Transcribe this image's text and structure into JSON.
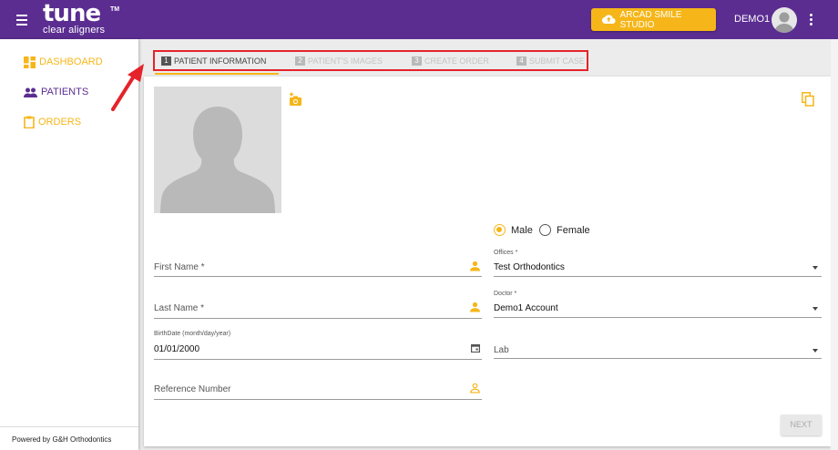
{
  "brand": {
    "logo_main": "tune",
    "logo_tm": "TM",
    "logo_sub": "clear aligners",
    "primary_color": "#5b2d91",
    "accent_color": "#f6b619"
  },
  "header": {
    "menu_icon": "hamburger-icon",
    "arcad_button_label": "ARCAD SMILE STUDIO",
    "arcad_icon": "cloud-upload-icon",
    "user_name": "DEMO1",
    "more_icon": "kebab-menu-icon"
  },
  "sidebar": {
    "items": [
      {
        "label": "DASHBOARD",
        "icon": "dashboard-icon"
      },
      {
        "label": "PATIENTS",
        "icon": "people-icon"
      },
      {
        "label": "ORDERS",
        "icon": "clipboard-icon"
      }
    ],
    "footer": "Powered by G&H Orthodontics"
  },
  "tabs": [
    {
      "num": "1",
      "label": "PATIENT INFORMATION",
      "active": true
    },
    {
      "num": "2",
      "label": "PATIENT'S IMAGES",
      "active": false
    },
    {
      "num": "3",
      "label": "CREATE ORDER",
      "active": false
    },
    {
      "num": "4",
      "label": "SUBMIT CASE",
      "active": false
    }
  ],
  "form": {
    "gender": {
      "male_label": "Male",
      "female_label": "Female",
      "selected": "Male"
    },
    "first_name": {
      "placeholder": "First Name *",
      "value": ""
    },
    "last_name": {
      "placeholder": "Last Name *",
      "value": ""
    },
    "birthdate": {
      "label": "BirthDate (month/day/year)",
      "value": "01/01/2000"
    },
    "reference_number": {
      "placeholder": "Reference Number",
      "value": ""
    },
    "offices": {
      "label": "Offices *",
      "value": "Test Orthodontics"
    },
    "doctor": {
      "label": "Doctor *",
      "value": "Demo1 Account"
    },
    "lab": {
      "placeholder": "Lab",
      "value": ""
    },
    "next_label": "NEXT"
  },
  "annotation": {
    "arrow_color": "#e5232a"
  }
}
